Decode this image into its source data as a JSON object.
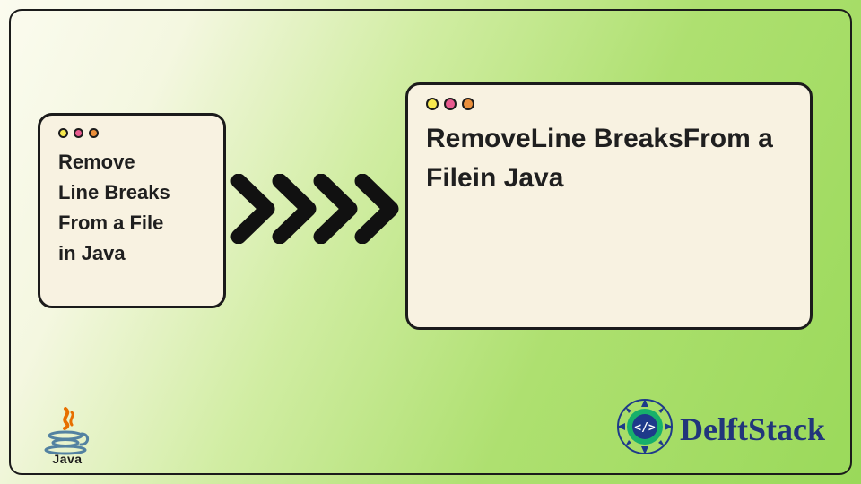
{
  "left_card": {
    "lines": "Remove\nLine Breaks\nFrom a File\nin Java"
  },
  "right_card": {
    "text": "RemoveLine BreaksFrom a Filein Java"
  },
  "arrow_count": 4,
  "java": {
    "label": "Java"
  },
  "brand": {
    "name": "DelftStack"
  },
  "colors": {
    "dot_yellow": "#f7e94f",
    "dot_pink": "#e85b8f",
    "dot_orange": "#ea8f3b",
    "brand_blue": "#21357b"
  }
}
